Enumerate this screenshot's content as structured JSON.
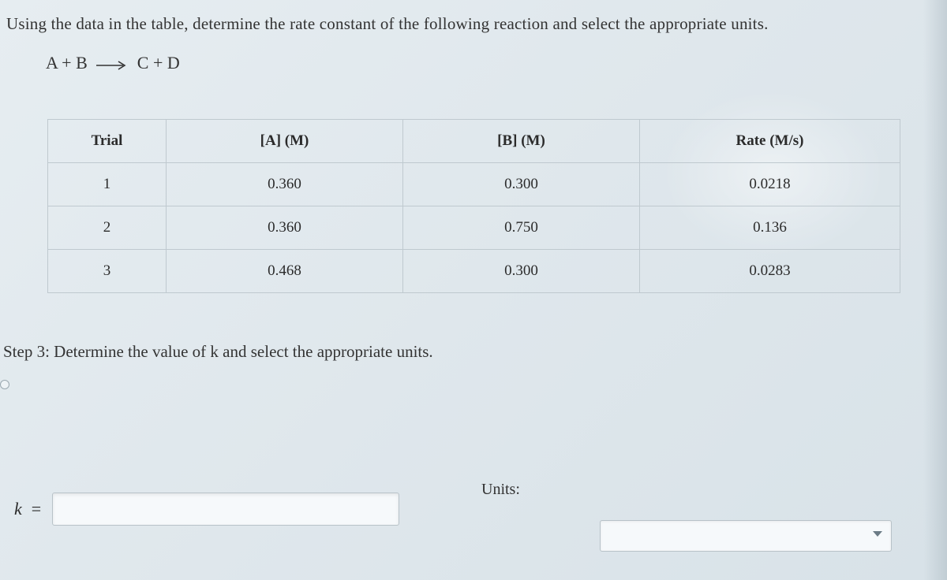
{
  "prompt": "Using the data in the table, determine the rate constant of the following reaction and select the appropriate units.",
  "equation": {
    "lhs": "A + B",
    "rhs": "C + D"
  },
  "table": {
    "headers": {
      "trial": "Trial",
      "a": "[A] (M)",
      "b": "[B] (M)",
      "rate": "Rate (M/s)"
    },
    "rows": [
      {
        "trial": "1",
        "a": "0.360",
        "b": "0.300",
        "rate": "0.0218"
      },
      {
        "trial": "2",
        "a": "0.360",
        "b": "0.750",
        "rate": "0.136"
      },
      {
        "trial": "3",
        "a": "0.468",
        "b": "0.300",
        "rate": "0.0283"
      }
    ]
  },
  "step_label": "Step 3: Determine the value of k and select the appropriate units.",
  "answer": {
    "k_symbol": "k",
    "equals": "=",
    "k_value": "",
    "units_label": "Units:",
    "units_value": ""
  }
}
